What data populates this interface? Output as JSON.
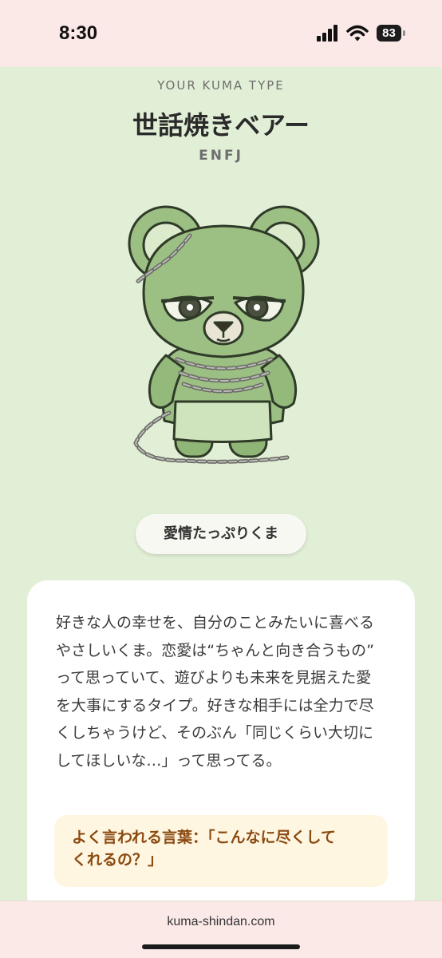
{
  "status": {
    "time": "8:30",
    "battery": "83",
    "icons": [
      "signal-icon",
      "wifi-icon",
      "battery-icon"
    ]
  },
  "result": {
    "kicker": "YOUR KUMA TYPE",
    "title": "世話焼きベアー",
    "code": "ENFJ",
    "tag": "愛情たっぷりくま"
  },
  "card": {
    "lines": [
      "好きな人の幸せを、自分のことみたいに喜べる",
      "やさしいくま。恋愛は“ちゃんと向き合うもの”",
      "って思っていて、遊びよりも未来を見据えた愛",
      "を大事にするタイプ。好きな相手には全力で尽",
      "くしちゃうけど、そのぶん「同じくらい大切に",
      "してほしいな…」って思ってる。"
    ],
    "quote_lines": [
      "よく言われる言葉：「こんなに尽くして",
      "くれるの？」"
    ]
  },
  "browser": {
    "url": "kuma-shindan.com"
  },
  "colors": {
    "page_bg": "#e2efd7",
    "bar_bg": "#fbe9e8",
    "bear_green": "#9cbf84",
    "quote_text": "#8a4a10",
    "quote_bg": "#fff6e2"
  }
}
